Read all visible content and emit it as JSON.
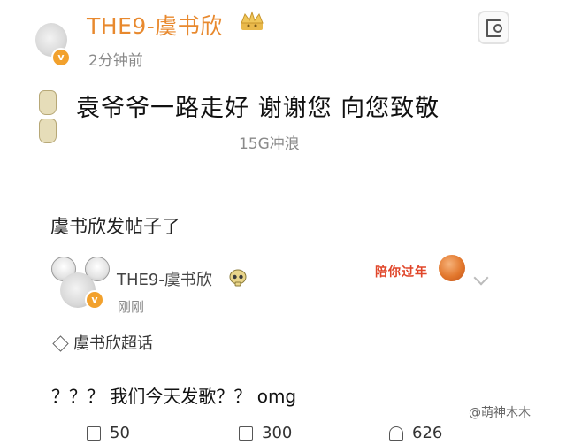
{
  "post": {
    "author": "THE9-虞书欣",
    "verified_badge": "v",
    "time": "2分钟前",
    "content": "袁爷爷一路走好 谢谢您 向您致敬",
    "source": "15G冲浪"
  },
  "reshare": {
    "title": "虞书欣发帖子了",
    "author": "THE9-虞书欣",
    "verified_badge": "v",
    "time": "刚刚",
    "banner_text": "陪你过年",
    "topic": "虞书欣超话",
    "content": "？？？ 我们今天发歌？？ omg",
    "actions": {
      "share_count": "50",
      "comment_count": "300",
      "like_count": "626"
    }
  },
  "watermark": "@萌神木木",
  "colors": {
    "author_name": "#e8892e",
    "meta_gray": "#8a8a8a",
    "verified_badge": "#f2a12d",
    "banner_red": "#e0462a"
  },
  "icons": [
    "more-options-icon",
    "crown-icon",
    "skull-icon",
    "basketball-icon",
    "supertopic-diamond-icon",
    "share-icon",
    "comment-icon",
    "like-icon"
  ]
}
